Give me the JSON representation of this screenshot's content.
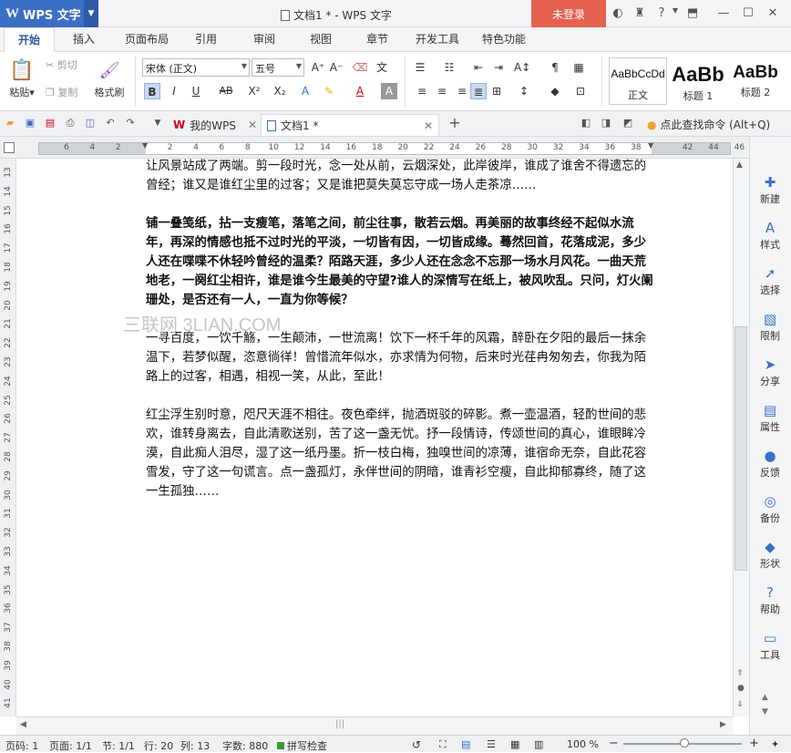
{
  "app": {
    "logo": "W",
    "name": "WPS 文字",
    "document_title": "文档1 * - WPS 文字",
    "login_button": "未登录"
  },
  "tabs": [
    "开始",
    "插入",
    "页面布局",
    "引用",
    "审阅",
    "视图",
    "章节",
    "开发工具",
    "特色功能"
  ],
  "ribbon": {
    "paste": "粘贴",
    "cut": "剪切",
    "copy": "复制",
    "format_painter": "格式刷",
    "font_name": "宋体 (正文)",
    "font_size": "五号",
    "bold": "B",
    "italic": "I",
    "underline": "U",
    "strikethrough": "AB",
    "superscript": "X²",
    "subscript": "X₂",
    "styles": [
      {
        "preview": "AaBbCcDd",
        "name": "正文"
      },
      {
        "preview": "AaBb",
        "name": "标题 1"
      },
      {
        "preview": "AaBb",
        "name": "标题 2"
      }
    ]
  },
  "doc_tabs": {
    "my_wps": "我的WPS",
    "current": "文档1 *",
    "add": "+"
  },
  "search_command": "点此查找命令 (Alt+Q)",
  "ruler": {
    "horizontal": [
      "6",
      "4",
      "2",
      "",
      "2",
      "4",
      "6",
      "8",
      "10",
      "12",
      "14",
      "16",
      "18",
      "20",
      "22",
      "24",
      "26",
      "28",
      "30",
      "32",
      "34",
      "36",
      "38",
      "",
      "42",
      "44",
      "46"
    ],
    "vertical": [
      "13",
      "14",
      "15",
      "16",
      "17",
      "18",
      "19",
      "20",
      "21",
      "22",
      "23",
      "24",
      "25",
      "26",
      "27",
      "28",
      "29",
      "30",
      "31",
      "32",
      "33",
      "34",
      "35",
      "36",
      "37",
      "38",
      "39",
      "40",
      "41"
    ]
  },
  "document": {
    "paragraphs": [
      "让风景站成了两端。剪一段时光，念一处从前，云烟深处，此岸彼岸，谁成了谁舍不得遗忘的曾经；谁又是谁红尘里的过客；又是谁把莫失莫忘守成一场人走茶凉……",
      "铺一叠笺纸，拈一支瘦笔，落笔之间，前尘往事，散若云烟。再美丽的故事终经不起似水流年，再深的情感也抵不过时光的平淡，一切皆有因，一切皆成缘。蓦然回首，花落成泥，多少人还在喋喋不休轻吟曾经的温柔？陌路天涯，多少人还在念念不忘那一场水月风花。一曲天荒地老，一阕红尘相许，谁是谁今生最美的守望?谁人的深情写在纸上，被风吹乱。只问，灯火阑珊处，是否还有一人，一直为你等候？",
      "一寻百度，一饮千觞，一生颠沛，一世流离！饮下一杯千年的风霜，醉卧在夕阳的最后一抹余温下，若梦似醒，恣意徜徉！曾惜流年似水，亦求情为何物，后来时光荏冉匆匆去，你我为陌路上的过客，相遇，相视一笑，从此，至此！",
      "红尘浮生别时意，咫尺天涯不相往。夜色牵绊，抛洒斑驳的碎影。煮一壶温酒，轻酌世间的悲欢，谁转身离去，自此清歌送别，苦了这一盏无忧。抒一段情诗，传颂世间的真心，谁眼眸冷漠，自此痴人泪尽，湿了这一纸丹墨。折一枝白梅，独嗅世间的凉薄，谁宿命无奈，自此花容雪发，守了这一句谎言。点一盏孤灯，永伴世间的阴暗，谁青衫空瘦，自此抑郁寡终，随了这一生孤独……"
    ]
  },
  "watermark": "三联网 3LIAN.COM",
  "right_panel": [
    "新建",
    "样式",
    "选择",
    "限制",
    "分享",
    "属性",
    "反馈",
    "备份",
    "形状",
    "帮助",
    "工具"
  ],
  "status": {
    "page_no": "页码: 1",
    "pages": "页面: 1/1",
    "section": "节: 1/1",
    "row": "行: 20",
    "column": "列: 13",
    "word_count": "字数: 880",
    "spell_check": "拼写检查",
    "zoom": "100 %"
  },
  "colors": {
    "accent": "#3b6fc4",
    "login": "#e4624f"
  }
}
